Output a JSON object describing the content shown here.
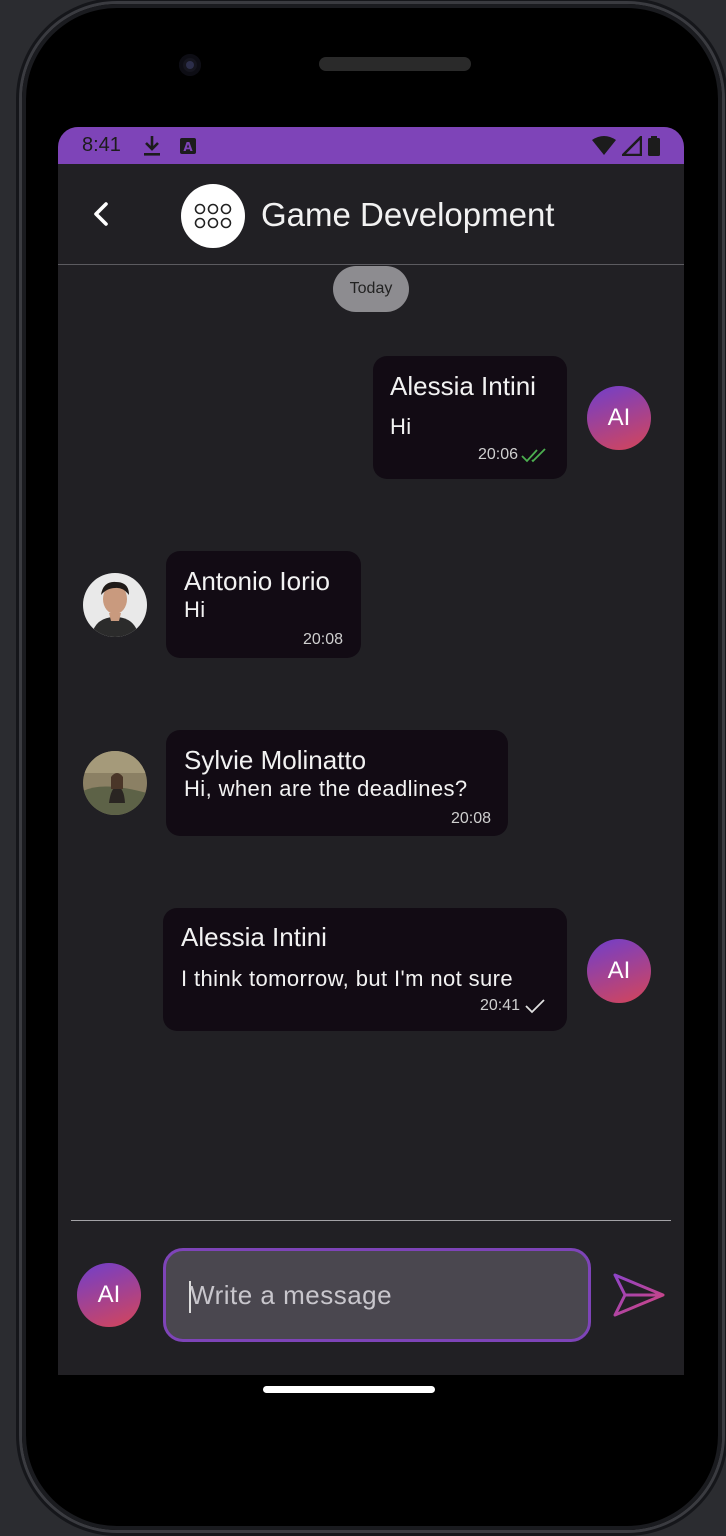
{
  "status": {
    "time": "8:41"
  },
  "header": {
    "title": "Game Development"
  },
  "date_chip": "Today",
  "messages": [
    {
      "sender": "Alessia Intini",
      "text": "Hi",
      "time": "20:06",
      "status": "read",
      "avatar_initials": "AI"
    },
    {
      "sender": "Antonio Iorio",
      "text": "Hi",
      "time": "20:08"
    },
    {
      "sender": "Sylvie Molinatto",
      "text": "Hi, when are the deadlines?",
      "time": "20:08"
    },
    {
      "sender": "Alessia Intini",
      "text": "I think tomorrow, but I'm not sure",
      "time": "20:41",
      "status": "sent",
      "avatar_initials": "AI"
    }
  ],
  "composer": {
    "avatar_initials": "AI",
    "placeholder": "Write a message"
  },
  "colors": {
    "accent": "#7e44b8",
    "bubble": "#120b14",
    "background": "#212024",
    "read_check": "#4caf50"
  }
}
